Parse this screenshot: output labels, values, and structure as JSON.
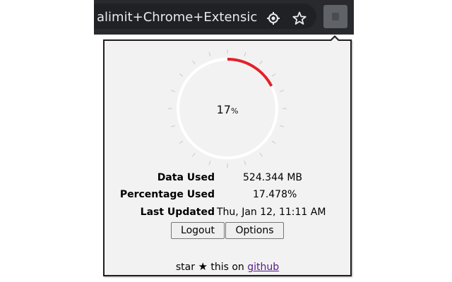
{
  "browser": {
    "omnibox_text": "alimit+Chrome+Extensic",
    "location_icon": "location-target-icon",
    "bookmark_icon": "star-outline-icon",
    "extension_icon": "extension-action-icon"
  },
  "popup": {
    "gauge": {
      "percent_display": "17",
      "percent_unit": "%",
      "fill_fraction": 0.17478,
      "fill_color": "#e3202a",
      "track_color": "#ffffff",
      "tick_color": "#cfcfcf"
    },
    "stats": [
      {
        "label": "Data Used",
        "value": "524.344 MB"
      },
      {
        "label": "Percentage Used",
        "value": "17.478%"
      },
      {
        "label": "Last Updated",
        "value": "Thu, Jan 12, 11:11 AM"
      }
    ],
    "buttons": {
      "logout": "Logout",
      "options": "Options"
    },
    "footer": {
      "prefix": "star",
      "star_glyph": "★",
      "middle": "this on",
      "link": "github"
    }
  }
}
